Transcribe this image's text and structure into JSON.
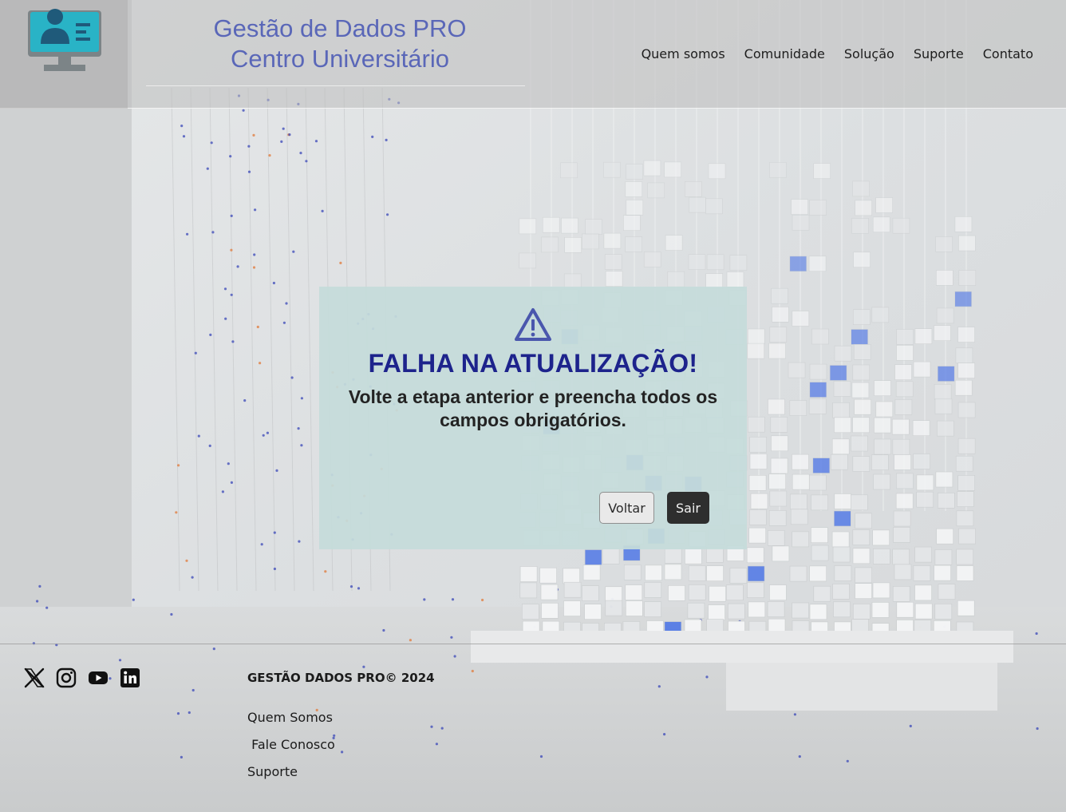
{
  "header": {
    "brand_line1": "Gestão de Dados PRO",
    "brand_line2": "Centro Universitário",
    "nav": [
      "Quem somos",
      "Comunidade",
      "Solução",
      "Suporte",
      "Contato"
    ]
  },
  "dialog": {
    "title": "FALHA NA ATUALIZAÇÃO!",
    "message": "Volte a etapa anterior e preencha todos os campos obrigatórios.",
    "back_label": "Voltar",
    "exit_label": "Sair"
  },
  "footer": {
    "copyright": "GESTÃO DADOS PRO© 2024",
    "links": [
      "Quem Somos",
      " Fale Conosco",
      "Suporte"
    ],
    "socials": [
      "x-icon",
      "instagram-icon",
      "youtube-icon",
      "linkedin-icon"
    ]
  },
  "colors": {
    "brand": "#5a67b8",
    "dialog_title": "#1d238c",
    "dialog_bg": "#c5dcda",
    "button_dark": "#2e2e2e",
    "logo_teal": "#29b3c6",
    "logo_navy": "#1f5a7a"
  }
}
